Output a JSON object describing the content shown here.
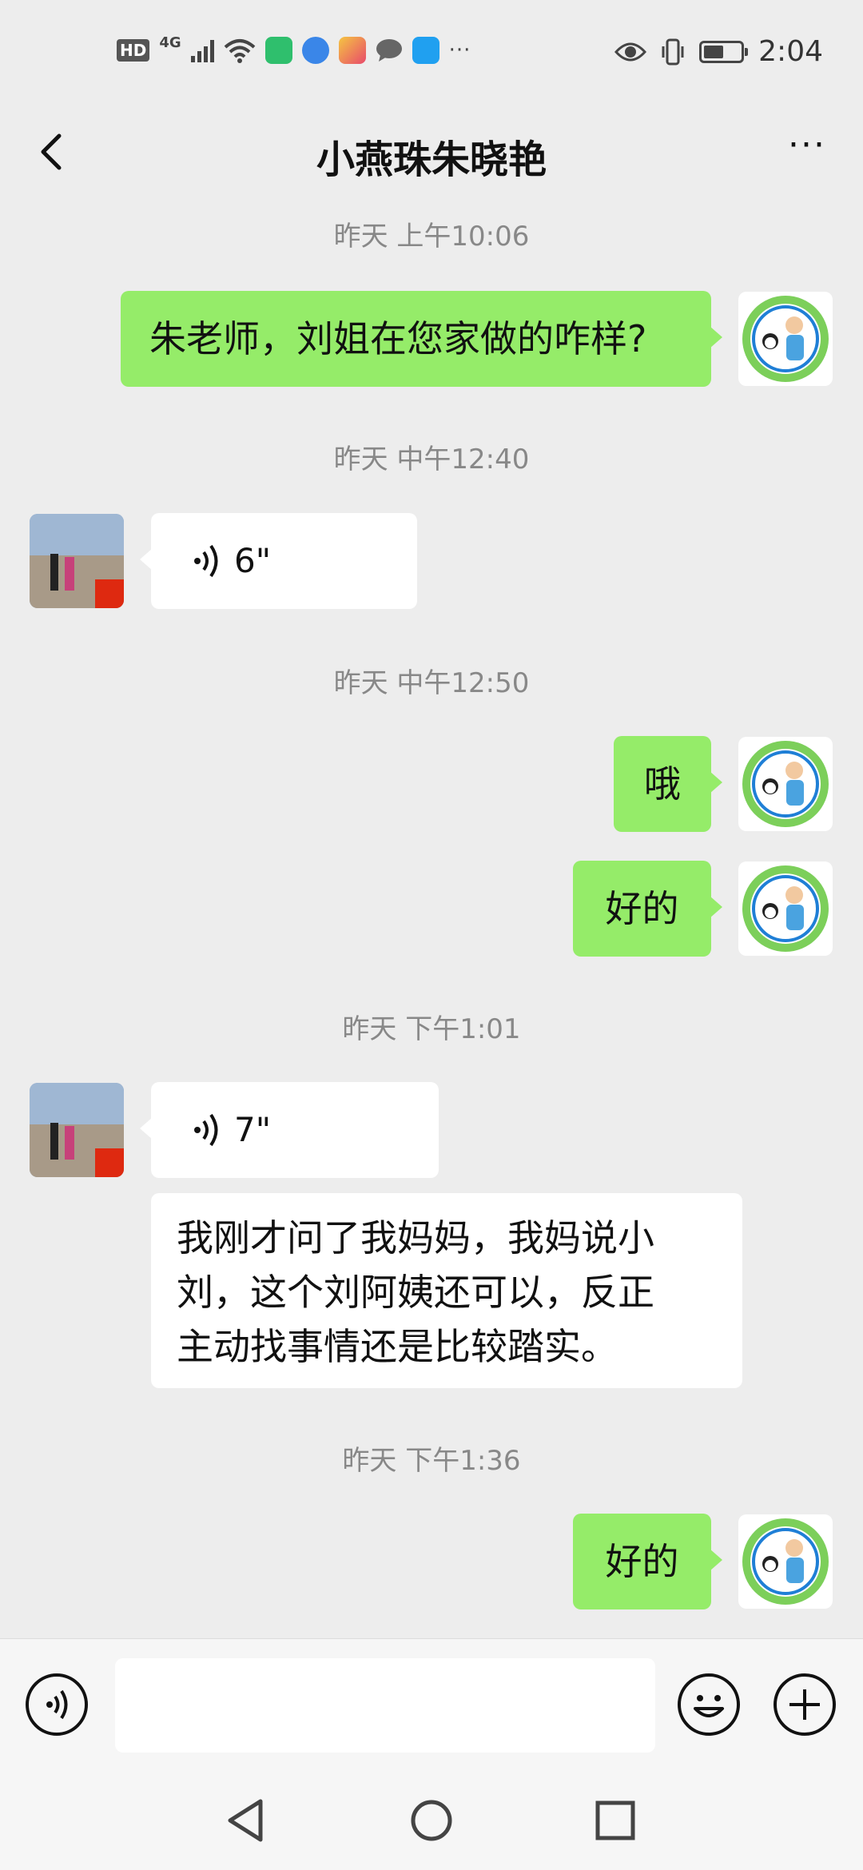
{
  "status_bar": {
    "hd": "HD",
    "network": "4G",
    "time": "2:04"
  },
  "header": {
    "title": "小燕珠朱晓艳",
    "more": "···"
  },
  "messages": [
    {
      "type": "timestamp",
      "text": "昨天 上午10:06"
    },
    {
      "type": "text",
      "side": "right",
      "text": "朱老师，刘姐在您家做的咋样?"
    },
    {
      "type": "timestamp",
      "text": "昨天 中午12:40"
    },
    {
      "type": "voice",
      "side": "left",
      "duration": "6\""
    },
    {
      "type": "timestamp",
      "text": "昨天 中午12:50"
    },
    {
      "type": "text",
      "side": "right",
      "text": "哦"
    },
    {
      "type": "text",
      "side": "right",
      "text": "好的"
    },
    {
      "type": "timestamp",
      "text": "昨天 下午1:01"
    },
    {
      "type": "voice",
      "side": "left",
      "duration": "7\""
    },
    {
      "type": "text",
      "side": "left",
      "lines": [
        "我刚才问了我妈妈，我妈说小",
        "刘，这个刘阿姨还可以，反正",
        "主动找事情还是比较踏实。"
      ]
    },
    {
      "type": "timestamp",
      "text": "昨天 下午1:36"
    },
    {
      "type": "text",
      "side": "right",
      "text": "好的"
    }
  ],
  "input_bar": {
    "voice_icon": "voice-toggle-icon",
    "emoji_icon": "emoji-icon",
    "plus_icon": "plus-icon"
  },
  "colors": {
    "sent_bubble": "#95ec69",
    "received_bubble": "#ffffff",
    "background": "#ededed"
  }
}
